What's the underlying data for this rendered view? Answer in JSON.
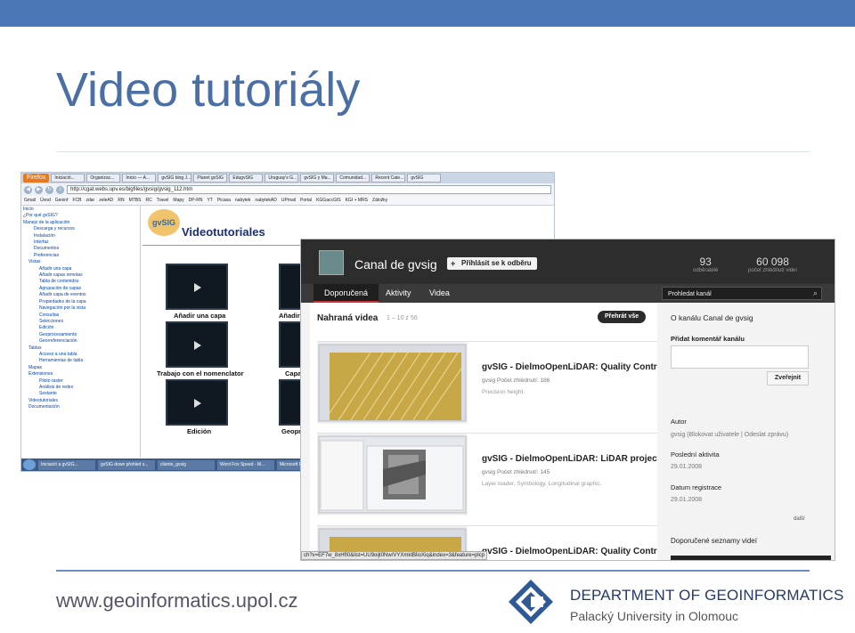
{
  "slide": {
    "title": "Video tutoriály",
    "footer_url": "www.geoinformatics.upol.cz",
    "dept_line1": "DEPARTMENT OF GEOINFORMATICS",
    "dept_line2": "Palacký University in Olomouc"
  },
  "browser": {
    "app_button": "Firefox",
    "tabs": [
      "Iniciació...",
      "Organizac...",
      "Inicio — A...",
      "gvSIG blog J...",
      "Planet gvSIG",
      "EdugvSIG",
      "Uruguay's G...",
      "gvSIG y Ma...",
      "Comunidad...",
      "Recent Cate...",
      "gvSIG"
    ],
    "url": "http://cgat.webs.upv.es/bigfiles/gvsig/gvsig_112.htm",
    "bookmarks": [
      "Gmail",
      "Úvod",
      "Geoinf",
      "FCB",
      "zdar",
      "zeleAD",
      "RN",
      "MTBS",
      "RC",
      "Travel",
      "Mapy",
      "DP-RN",
      "YT",
      "Picasa",
      "nabytek",
      "nabytekAD",
      "UPmail",
      "Portal",
      "KGGaccGIS",
      "KGI + MRS",
      "Záložky"
    ],
    "tree": [
      "Inicio",
      "¿Por qué gvSIG?",
      "Manejo de la aplicación",
      "Descarga y recursos",
      "Instalación",
      "Interfaz",
      "Documentos",
      "Preferencias",
      "Vistas",
      "Añadir una capa",
      "Añadir capas remotas",
      "Tabla de contenidos",
      "Agrupación de capas",
      "Añadir capa de eventos",
      "Propiedades de la capa",
      "Navegación por la vista",
      "Consultas",
      "Selecciones",
      "Edición",
      "Geoprocesamiento",
      "Georreferenciación",
      "Tablas",
      "Acceso a una tabla",
      "Herramientas de tabla",
      "Mapas",
      "Extensiones",
      "Piloto raster",
      "Análisis de redes",
      "Sextante",
      "Videotutoriales",
      "Documentación"
    ],
    "logo_text": "gvSIG",
    "heading": "Videotutoriales",
    "videos": [
      "Añadir una capa",
      "Añadir",
      "Trabajo con el nomenclator",
      "Capa",
      "Edición",
      "Geopr"
    ],
    "taskbar": [
      "Iniciació a gvSIG...",
      "gvSIG down přehled s...",
      "cliente_gvsig",
      "Word Fox Speed - M...",
      "Microsoft PowerPoint..."
    ]
  },
  "youtube": {
    "channel_name": "Canal de gvsig",
    "subscribe": "Přihlásit se k odběru",
    "subscribers": "93",
    "subscribers_label": "odběratelé",
    "views": "60 098",
    "views_label": "počet zhlédnutí videí",
    "tabs": [
      "Doporučená",
      "Aktivity",
      "Videa"
    ],
    "search": "Prohledat kanál",
    "section": "Nahraná videa",
    "count": "1 – 10 z 56",
    "play_all": "Přehrát vše",
    "videos": [
      {
        "title": "gvSIG - DielmoOpenLiDAR: Quality Contr",
        "meta": "gvsig   Počet zhlédnutí: 186",
        "desc": "Precision height."
      },
      {
        "title": "gvSIG - DielmoOpenLiDAR: LiDAR project",
        "meta": "gvsig   Počet zhlédnutí: 145",
        "desc": "Layer loader, Symbology, Longitudinal graphic."
      },
      {
        "title": "gvSIG - DielmoOpenLiDAR: Quality Contr",
        "meta": "",
        "desc": ""
      }
    ],
    "about": "O kanálu Canal de gvsig",
    "add_comment": "Přidat komentář kanálu",
    "post_btn": "Zveřejnit",
    "author_h": "Autor",
    "author": "gvsig  (Blokovat uživatele | Odeslat zprávu)",
    "last_activity_h": "Poslední aktivita",
    "last_activity": "29.01.2008",
    "reg_h": "Datum registrace",
    "reg": "29.01.2008",
    "more": "další",
    "playlists": "Doporučené seznamy videí",
    "status_url": "ch?v=EF7w_8xHfI0&list=UU9oijt0Nw/VYXmktBlioXiq&index=3&feature=plcp"
  }
}
